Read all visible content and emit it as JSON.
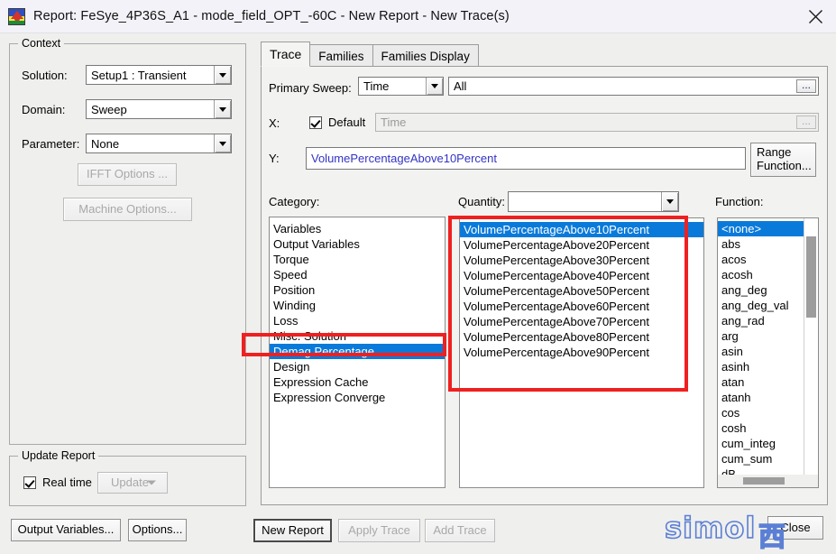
{
  "window": {
    "title": "Report: FeSye_4P36S_A1 - mode_field_OPT_-60C - New Report - New Trace(s)",
    "app_icon": "maxwell-app-icon",
    "close_icon": "close-icon"
  },
  "context": {
    "legend": "Context",
    "solution_label": "Solution:",
    "solution_value": "Setup1 : Transient",
    "domain_label": "Domain:",
    "domain_value": "Sweep",
    "parameter_label": "Parameter:",
    "parameter_value": "None",
    "ifft_button": "IFFT Options ...",
    "machine_button": "Machine Options..."
  },
  "update_report": {
    "legend": "Update Report",
    "realtime_label": "Real time",
    "realtime_checked": true,
    "update_button": "Update"
  },
  "bottom_left_buttons": {
    "output_variables": "Output Variables...",
    "options": "Options..."
  },
  "tabs": [
    {
      "label": "Trace",
      "active": true
    },
    {
      "label": "Families",
      "active": false
    },
    {
      "label": "Families Display",
      "active": false
    }
  ],
  "trace": {
    "primary_sweep_label": "Primary Sweep:",
    "primary_sweep_value": "Time",
    "primary_sweep_range": "All",
    "primary_sweep_ellipsis": "...",
    "x_label": "X:",
    "x_default_label": "Default",
    "x_default_checked": true,
    "x_value": "Time",
    "x_ellipsis": "...",
    "y_label": "Y:",
    "y_value": "VolumePercentageAbove10Percent",
    "range_function_button_line1": "Range",
    "range_function_button_line2": "Function..."
  },
  "category": {
    "label": "Category:",
    "items": [
      "Variables",
      "Output Variables",
      "Torque",
      "Speed",
      "Position",
      "Winding",
      "Loss",
      "Misc. Solution",
      "Demag Percentage",
      "Design",
      "Expression Cache",
      "Expression Converge"
    ],
    "selected": "Demag Percentage",
    "selected_index": 8
  },
  "quantity": {
    "label": "Quantity:",
    "filter_value": "",
    "items": [
      "VolumePercentageAbove10Percent",
      "VolumePercentageAbove20Percent",
      "VolumePercentageAbove30Percent",
      "VolumePercentageAbove40Percent",
      "VolumePercentageAbove50Percent",
      "VolumePercentageAbove60Percent",
      "VolumePercentageAbove70Percent",
      "VolumePercentageAbove80Percent",
      "VolumePercentageAbove90Percent"
    ],
    "selected": "VolumePercentageAbove10Percent",
    "selected_index": 0
  },
  "function": {
    "label": "Function:",
    "items": [
      "<none>",
      "abs",
      "acos",
      "acosh",
      "ang_deg",
      "ang_deg_val",
      "ang_rad",
      "arg",
      "asin",
      "asinh",
      "atan",
      "atanh",
      "cos",
      "cosh",
      "cum_integ",
      "cum_sum",
      "dB"
    ],
    "selected": "<none>",
    "selected_index": 0
  },
  "action_buttons": {
    "new_report": "New Report",
    "new_report_mnemonic": "N",
    "apply_trace": "Apply Trace",
    "add_trace": "Add Trace",
    "close": "Close"
  },
  "watermark": {
    "text": "simol",
    "cjk": "西"
  },
  "annotations": {
    "color": "#ef2020",
    "boxes": [
      {
        "name": "category-selection-highlight"
      },
      {
        "name": "quantity-list-highlight"
      }
    ]
  }
}
